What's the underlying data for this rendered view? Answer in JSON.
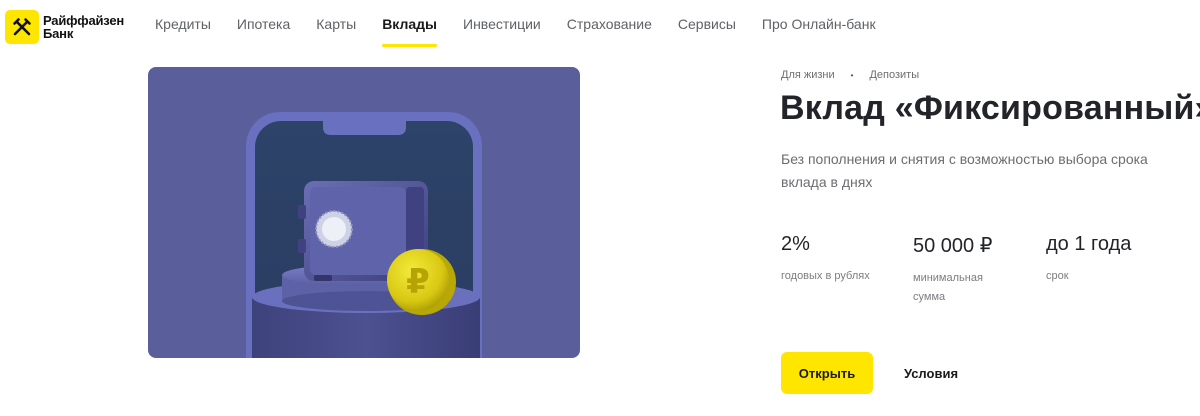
{
  "brand": {
    "name_line1": "Райффайзен",
    "name_line2": "Банк",
    "accent": "#fee600"
  },
  "nav": {
    "items": [
      {
        "label": "Кредиты",
        "active": false
      },
      {
        "label": "Ипотека",
        "active": false
      },
      {
        "label": "Карты",
        "active": false
      },
      {
        "label": "Вклады",
        "active": true
      },
      {
        "label": "Инвестиции",
        "active": false
      },
      {
        "label": "Страхование",
        "active": false
      },
      {
        "label": "Сервисы",
        "active": false
      },
      {
        "label": "Про Онлайн-банк",
        "active": false
      }
    ]
  },
  "hero": {
    "icons": [
      "phone-frame-icon",
      "safe-icon",
      "ruble-coin-icon"
    ],
    "background": "#5a5f9b"
  },
  "breadcrumbs": {
    "items": [
      "Для жизни",
      "Депозиты"
    ],
    "separator": "•"
  },
  "product": {
    "title": "Вклад «Фиксированный»",
    "subtitle": "Без пополнения и снятия с возможностью выбора срока вклада в днях"
  },
  "stats": [
    {
      "value": "2%",
      "label": "годовых в рублях"
    },
    {
      "value": "50 000 ₽",
      "label": "минимальная сумма"
    },
    {
      "value": "до 1 года",
      "label": "срок"
    }
  ],
  "actions": {
    "open_label": "Открыть",
    "terms_label": "Условия"
  }
}
